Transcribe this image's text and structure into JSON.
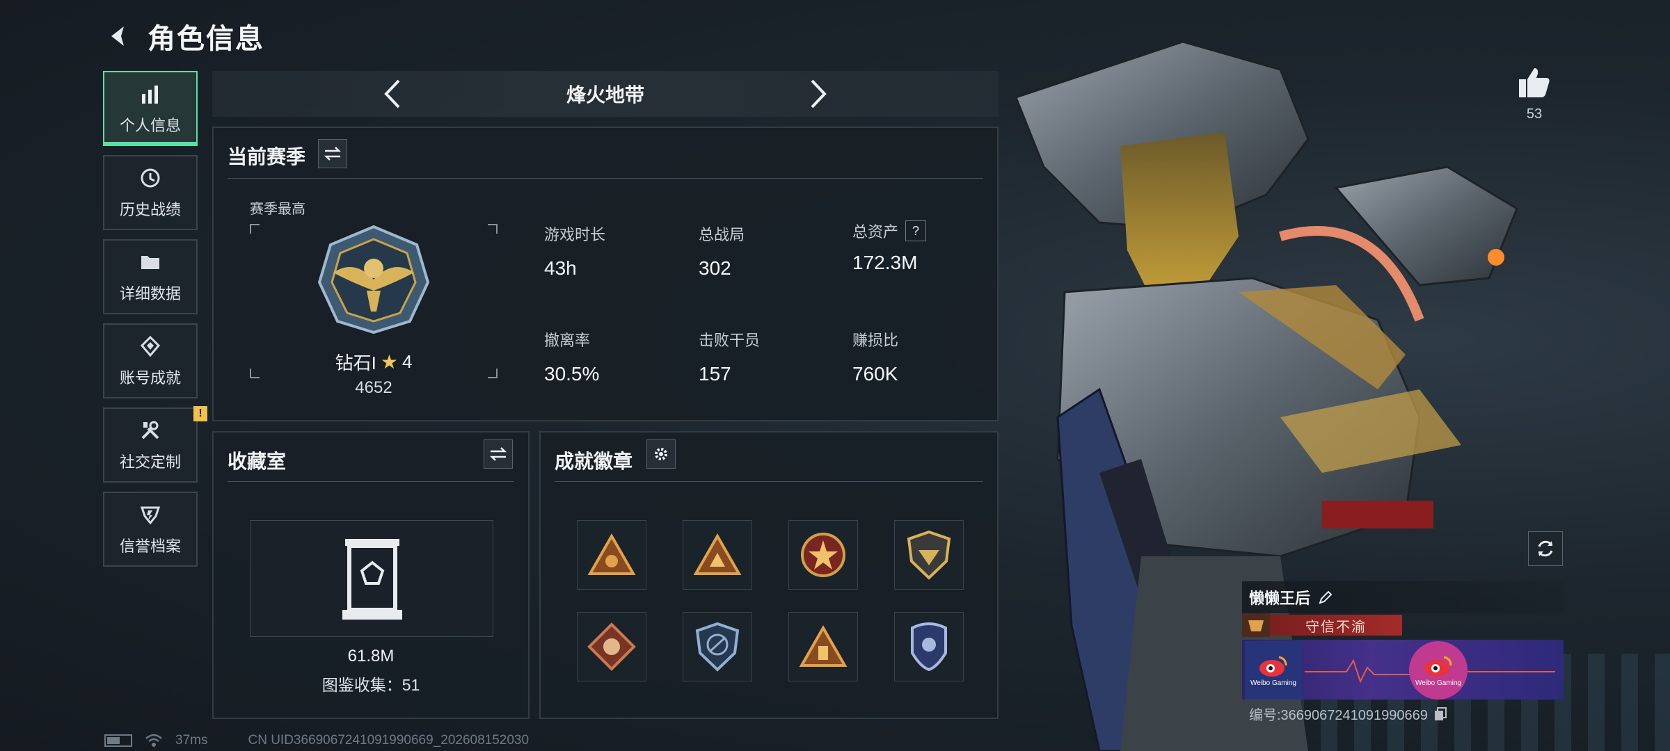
{
  "header": {
    "title": "角色信息"
  },
  "sidebar": {
    "items": [
      {
        "label": "个人信息",
        "icon": "bar-chart-icon",
        "active": true
      },
      {
        "label": "历史战绩",
        "icon": "history-clock-icon"
      },
      {
        "label": "详细数据",
        "icon": "folder-icon"
      },
      {
        "label": "账号成就",
        "icon": "achievement-icon"
      },
      {
        "label": "社交定制",
        "icon": "tools-icon",
        "alert": "!"
      },
      {
        "label": "信誉档案",
        "icon": "reputation-icon"
      }
    ]
  },
  "mode_selector": {
    "title": "烽火地带"
  },
  "season": {
    "title": "当前赛季",
    "subtitle": "赛季最高",
    "rank_name": "钻石I",
    "rank_stars": "4",
    "rank_points": "4652",
    "stats": [
      {
        "label": "游戏时长",
        "value": "43h"
      },
      {
        "label": "总战局",
        "value": "302"
      },
      {
        "label": "总资产",
        "value": "172.3M",
        "help": "?"
      },
      {
        "label": "撤离率",
        "value": "30.5%"
      },
      {
        "label": "击败干员",
        "value": "157"
      },
      {
        "label": "赚损比",
        "value": "760K"
      }
    ]
  },
  "collection": {
    "title": "收藏室",
    "value": "61.8M",
    "count_text": "图鉴收集：51"
  },
  "badges": {
    "title": "成就徽章",
    "items": [
      {
        "icon": "triangle-badge-icon",
        "color": "#c9772d"
      },
      {
        "icon": "triangle-crest-badge-icon",
        "color": "#c9772d"
      },
      {
        "icon": "star-round-badge-icon",
        "color": "#b8442e"
      },
      {
        "icon": "shield-gold-badge-icon",
        "color": "#c7a24a"
      },
      {
        "icon": "diamond-wolf-badge-icon",
        "color": "#9a4a32"
      },
      {
        "icon": "shield-blue-badge-icon",
        "color": "#4b78a6"
      },
      {
        "icon": "triangle-ammo-badge-icon",
        "color": "#c9772d"
      },
      {
        "icon": "police-badge-icon",
        "color": "#5c6fa8"
      }
    ]
  },
  "likes": {
    "count": "53"
  },
  "player": {
    "name": "懒懒王后",
    "title": "守信不渝",
    "id_text": "编号:3669067241091990669"
  },
  "status": {
    "ping": "37ms",
    "uid": "CN UID3669067241091990669_202608152030"
  },
  "colors": {
    "accent": "#59e0a8",
    "warning": "#f2c14a",
    "title_red": "#a32b2b"
  }
}
